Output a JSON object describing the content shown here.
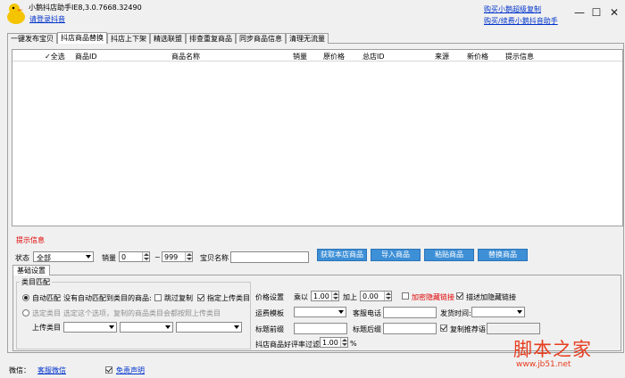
{
  "app": {
    "title": "小鹅抖店助手IE8,3.0.7668.32490",
    "login_link": "请登录抖音"
  },
  "header": {
    "buy_link1": "购买小鹅超级复制",
    "buy_link2": "购买/续费小鹅抖音助手"
  },
  "window": {
    "minimize": "—",
    "maximize": "☐",
    "close": "✕"
  },
  "tabs": [
    "一键发布宝贝",
    "抖店商品替换",
    "抖店上下架",
    "精选联盟",
    "排查重复商品",
    "同步商品信息",
    "清理无流量"
  ],
  "grid": {
    "select_all": "全选",
    "columns": [
      "商品ID",
      "商品名称",
      "销量",
      "原价格",
      "总店ID",
      "来源",
      "新价格",
      "提示信息"
    ]
  },
  "tips_label": "提示信息",
  "toolbar": {
    "status_label": "状态",
    "status_value": "全部",
    "sales_label": "销量",
    "sales_min": "0",
    "sales_dash": "~",
    "sales_max": "999",
    "name_label": "宝贝名称",
    "name_value": "",
    "buttons": [
      "获取本店商品",
      "导入商品",
      "粘贴商品",
      "替换商品"
    ]
  },
  "settings": {
    "tab_label": "基础设置",
    "group_label": "类目匹配",
    "auto_match_label": "自动匹配",
    "auto_match_desc": "没有自动匹配到类目的商品:",
    "skip_copy": "跳过复制",
    "designate_category": "指定上传类目",
    "select_category_label": "选定类目",
    "select_category_desc": "选定这个选项，复制的商品类目会都按照上传类目",
    "upload_category_label": "上传类目",
    "price_label": "价格设置",
    "multiply_label": "乘以",
    "multiply_value": "1.00",
    "add_label": "加上",
    "add_value": "0.00",
    "encrypt_link": "加密隐藏链接",
    "filter_hidden_link": "描述加隐藏链接",
    "freight_label": "运费模板",
    "service_phone_label": "客服电话",
    "ship_time_label": "发货时间:",
    "title_prefix_label": "标题前缀",
    "title_suffix_label": "标题后缀",
    "copy_recommend": "复制推荐语",
    "review_filter_label": "抖店商品好评率过滤",
    "review_filter_value": "1.00",
    "percent": "%"
  },
  "footer": {
    "wechat_label": "微信：",
    "wechat_link": "客服微信",
    "disclaimer": "免责声明"
  },
  "watermark": {
    "brand": "脚本之家",
    "url": "www.jb51.net"
  },
  "colors": {
    "accent_button": "#3d8fd6",
    "tips_red": "#e00000",
    "link_blue": "#0033cc"
  }
}
